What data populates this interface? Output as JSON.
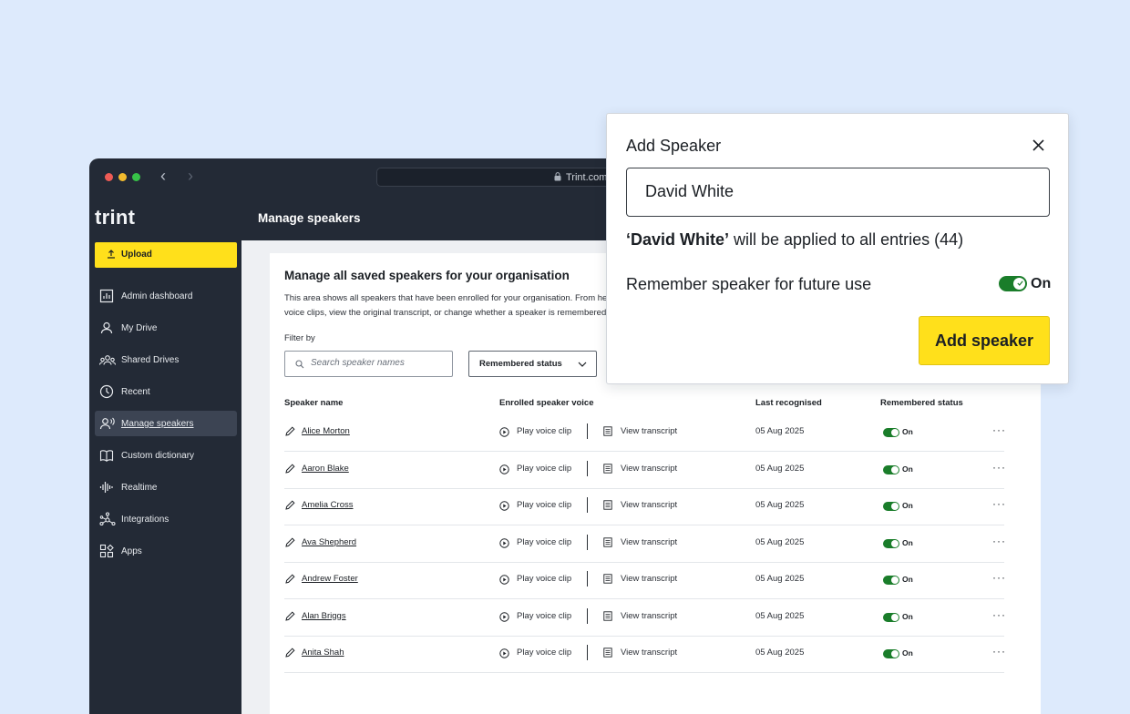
{
  "browser": {
    "url": "Trint.com"
  },
  "sidebar": {
    "logo": "trint",
    "upload_label": "Upload",
    "items": [
      {
        "label": "Admin dashboard",
        "icon": "chart-icon"
      },
      {
        "label": "My Drive",
        "icon": "user-icon"
      },
      {
        "label": "Shared Drives",
        "icon": "group-icon"
      },
      {
        "label": "Recent",
        "icon": "clock-icon"
      },
      {
        "label": "Manage speakers",
        "icon": "speaker-icon",
        "active": true
      },
      {
        "label": "Custom dictionary",
        "icon": "book-icon"
      },
      {
        "label": "Realtime",
        "icon": "waveform-icon"
      },
      {
        "label": "Integrations",
        "icon": "network-icon"
      },
      {
        "label": "Apps",
        "icon": "apps-icon"
      }
    ]
  },
  "header": {
    "title": "Manage speakers"
  },
  "main": {
    "card_title": "Manage all saved speakers for your organisation",
    "description": "This area shows all speakers that have been enrolled for your organisation. From her voice clips, view the original transcript, or change whether a speaker is remembered",
    "filter_label": "Filter by",
    "search_placeholder": "Search speaker names",
    "status_filter": "Remembered status",
    "columns": {
      "name": "Speaker name",
      "voice": "Enrolled speaker voice",
      "last": "Last recognised",
      "status": "Remembered status"
    },
    "play_label": "Play voice clip",
    "transcript_label": "View transcript",
    "rows": [
      {
        "name": "Alice Morton",
        "date": "05 Aug 2025",
        "status": "On"
      },
      {
        "name": "Aaron Blake",
        "date": "05 Aug 2025",
        "status": "On"
      },
      {
        "name": "Amelia Cross",
        "date": "05 Aug 2025",
        "status": "On"
      },
      {
        "name": "Ava Shepherd",
        "date": "05 Aug 2025",
        "status": "On"
      },
      {
        "name": "Andrew Foster",
        "date": "05 Aug 2025",
        "status": "On"
      },
      {
        "name": "Alan Briggs",
        "date": "05 Aug 2025",
        "status": "On"
      },
      {
        "name": "Anita Shah",
        "date": "05 Aug 2025",
        "status": "On"
      }
    ]
  },
  "dialog": {
    "title": "Add Speaker",
    "input_value": "David White",
    "applied_name": "‘David White’",
    "applied_rest": " will be applied to all entries (44)",
    "remember_label": "Remember speaker for future use",
    "toggle_label": "On",
    "button_label": "Add speaker"
  },
  "colors": {
    "accent": "#ffe01b",
    "toggle_on": "#1a7d2a",
    "sidebar": "#232a36",
    "page_bg": "#ddeafc"
  }
}
